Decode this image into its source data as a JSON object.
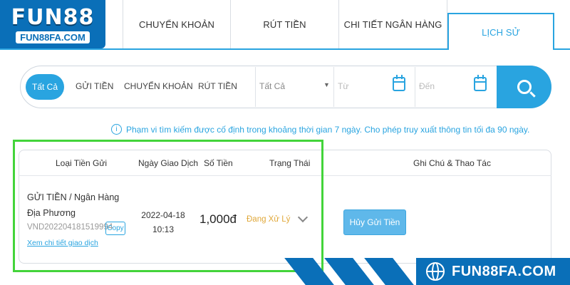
{
  "brand": {
    "logo_main": "FUN88",
    "logo_sub": "FUN88FA.COM",
    "watermark": "FUN88FA.COM",
    "accent": "#29a4e0",
    "logo_blue": "#0a6fb8",
    "highlight_green": "#43d43a"
  },
  "tabs": [
    {
      "label": "CHUYỂN KHOẢN"
    },
    {
      "label": "RÚT TIỀN"
    },
    {
      "label": "CHI TIẾT NGÂN HÀNG"
    },
    {
      "label": "LỊCH SỬ",
      "active": true
    }
  ],
  "filter": {
    "types": [
      "Tất Cả",
      "GỬI TIỀN",
      "CHUYỂN KHOẢN",
      "RÚT TIỀN"
    ],
    "select_value": "Tất Cả",
    "from_placeholder": "Từ",
    "to_placeholder": "Đến",
    "search_icon": "search-icon"
  },
  "info_text": "Phạm vi tìm kiếm được cố định trong khoảng thời gian 7 ngày. Cho phép truy xuất thông tin tối đa 90 ngày.",
  "table": {
    "headers": [
      "Loại Tiền Gửi",
      "Ngày Giao Dịch",
      "Số Tiền",
      "Trạng Thái",
      "Ghi Chú & Thao Tác"
    ],
    "rows": [
      {
        "type": "GỬI TIỀN / Ngân Hàng Địa Phương",
        "code": "VND202204181519994",
        "copy_label": "Copy",
        "detail_link": "Xem chi tiết giao dịch",
        "date": "2022-04-18",
        "time": "10:13",
        "amount": "1,000đ",
        "status": "Đang Xử Lý",
        "action_label": "Hủy Gửi Tiền"
      }
    ]
  }
}
